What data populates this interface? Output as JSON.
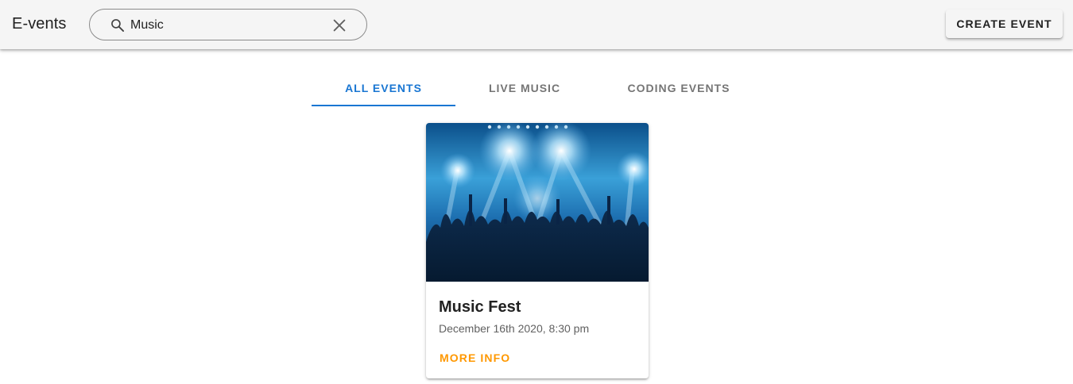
{
  "header": {
    "brand": "E-vents",
    "search": {
      "value": "Music",
      "placeholder": ""
    },
    "create_label": "CREATE EVENT"
  },
  "tabs": [
    {
      "label": "ALL EVENTS",
      "active": true
    },
    {
      "label": "LIVE MUSIC",
      "active": false
    },
    {
      "label": "CODING EVENTS",
      "active": false
    }
  ],
  "events": [
    {
      "title": "Music Fest",
      "datetime": "December 16th 2020, 8:30 pm",
      "action": "MORE INFO",
      "image": "concert-crowd-image"
    }
  ],
  "colors": {
    "primary": "#1976d2",
    "accent": "#ff9800",
    "appbar": "#f5f5f5"
  }
}
